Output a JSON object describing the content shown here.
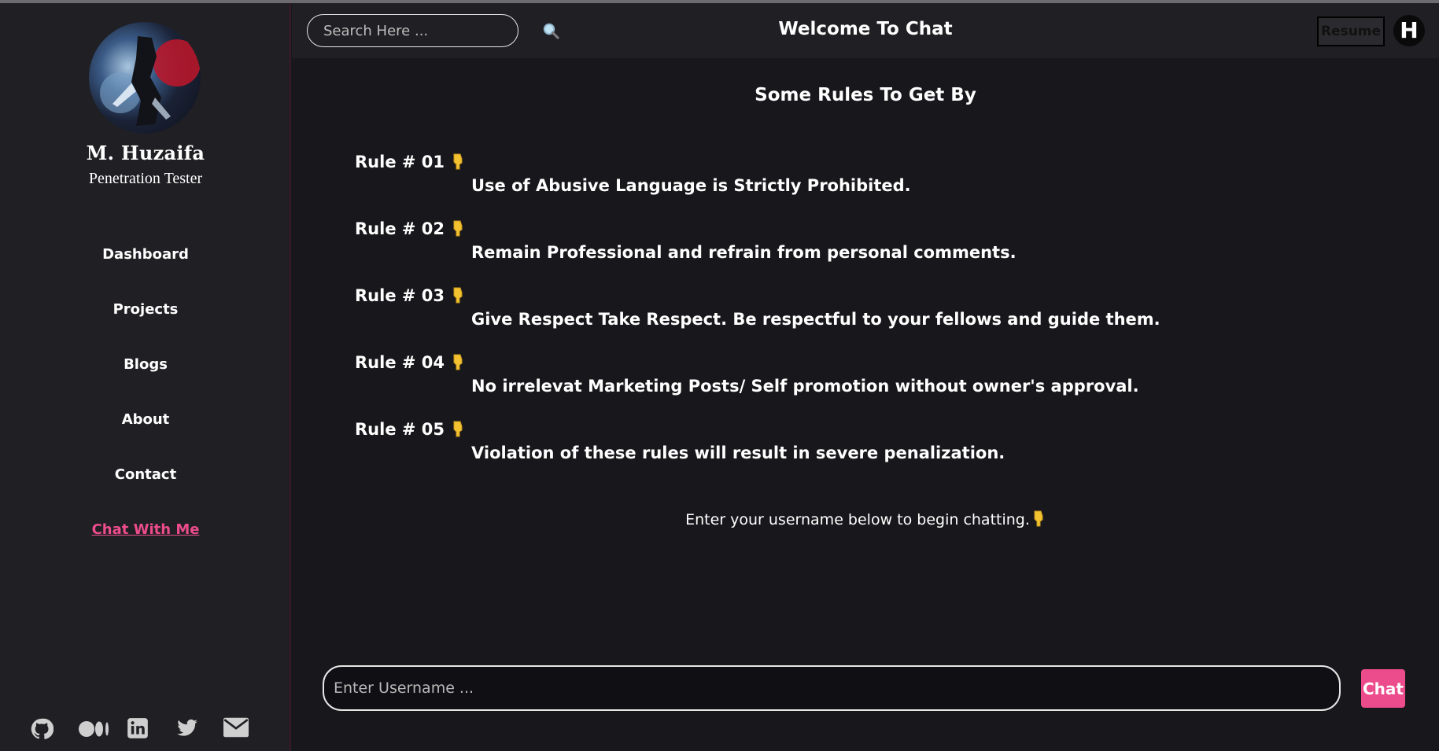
{
  "sidebar": {
    "profile": {
      "name": "M. Huzaifa",
      "title": "Penetration Tester"
    },
    "nav": [
      {
        "label": "Dashboard"
      },
      {
        "label": "Projects"
      },
      {
        "label": "Blogs"
      },
      {
        "label": "About"
      },
      {
        "label": "Contact"
      },
      {
        "label": "Chat With Me",
        "active": true
      }
    ],
    "socials": [
      "github-icon",
      "medium-icon",
      "linkedin-icon",
      "twitter-icon",
      "mail-icon"
    ]
  },
  "header": {
    "search_placeholder": "Search Here ...",
    "title": "Welcome To Chat",
    "resume_label": "Resume",
    "logo_letter": "H"
  },
  "rules": {
    "title": "Some Rules To Get By",
    "items": [
      {
        "label": "Rule # 01",
        "text": "Use of Abusive Language is Strictly Prohibited."
      },
      {
        "label": "Rule # 02",
        "text": "Remain Professional and refrain from personal comments."
      },
      {
        "label": "Rule # 03",
        "text": "Give Respect Take Respect. Be respectful to your fellows and guide them."
      },
      {
        "label": "Rule # 04",
        "text": "No irrelevat Marketing Posts/ Self promotion without owner's approval."
      },
      {
        "label": "Rule # 05",
        "text": "Violation of these rules will result in severe penalization."
      }
    ],
    "hint": "Enter your username below to begin chatting."
  },
  "chat": {
    "username_placeholder": "Enter Username ...",
    "button_label": "Chat"
  },
  "colors": {
    "accent": "#ec4c8c",
    "background": "#18181c",
    "panel": "#202024",
    "hand": "#f2c230"
  }
}
